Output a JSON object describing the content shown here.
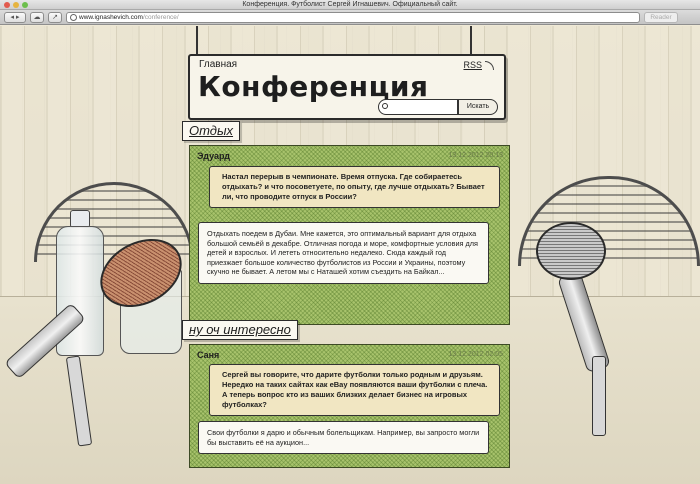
{
  "window": {
    "title": "Конференция. Футболист Сергей Игнашевич. Официальный сайт.",
    "url_host": "www.ignashevich.com",
    "url_path": "/conference/",
    "reader_label": "Reader"
  },
  "header": {
    "home_label": "Главная",
    "rss_label": "RSS",
    "page_title": "Конференция",
    "search_button": "Искать"
  },
  "topics": [
    {
      "title": "Отдых",
      "author": "Эдуард",
      "date": "13.12.2012 20:13",
      "question": "Настал перерыв в чемпионате. Время отпуска. Где собираетесь отдыхать? и что посоветуете, по опыту, где лучше отдыхать? Бывает ли, что проводите отпуск в России?",
      "answer": "Отдыхать поедем в Дубаи. Мне кажется, это оптимальный вариант для отдыха большой семьёй в декабре. Отличная погода и море, комфортные условия для детей и взрослых. И лететь относительно недалеко. Сюда каждый год приезжает большое количество футболистов из России и Украины, поэтому скучно не бывает. А летом мы с Наташей хотим съездить на Байкал..."
    },
    {
      "title": "ну оч интересно",
      "author": "Саня",
      "date": "13.12.2012 02:05",
      "question": "Сергей вы говорите, что дарите футболки только родным и друзьям. Нередко на таких сайтах как eBay появляются ваши футболки с плеча. А теперь вопрос кто из ваших близких делает бизнес на игровых футболках?",
      "answer": "Свои футболки я дарю и обычным болельщикам. Например, вы запросто могли бы выставить её на аукцион..."
    }
  ],
  "icons": [
    "globe-icon",
    "rss-icon",
    "search-icon"
  ],
  "colors": {
    "post_green": "#a8c36c",
    "question_bg": "#f1e6c2",
    "answer_bg": "#faf9f3",
    "page_bg": "#efe9d6"
  }
}
